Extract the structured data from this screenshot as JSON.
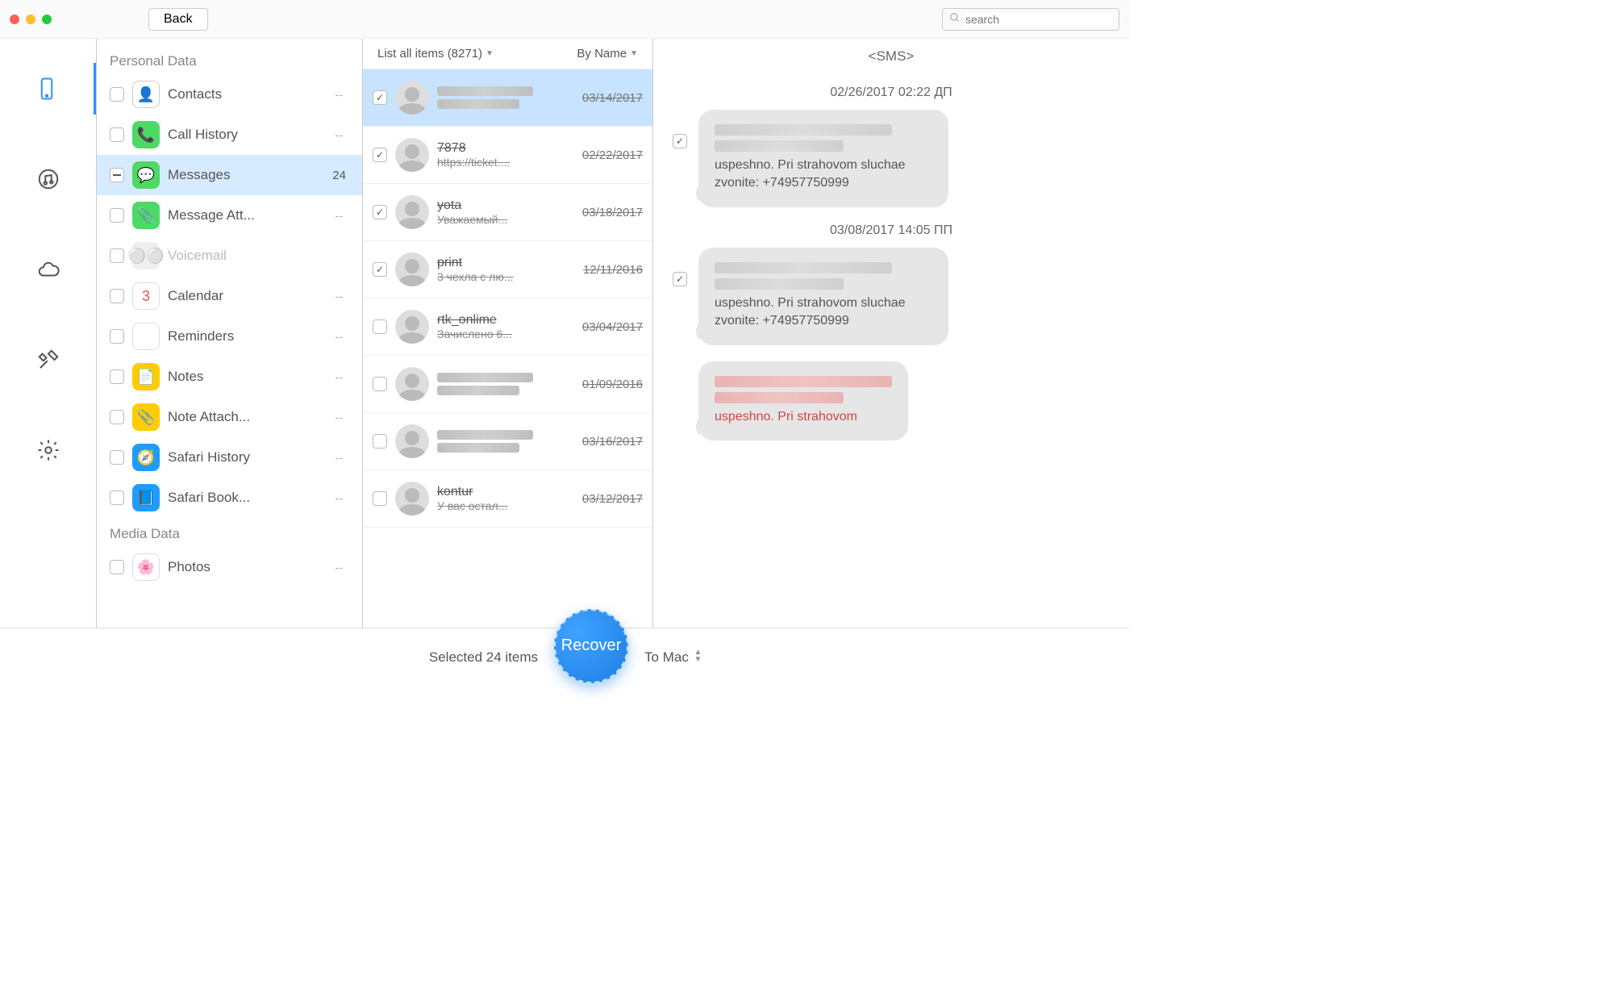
{
  "toolbar": {
    "back_label": "Back",
    "search_placeholder": "search"
  },
  "sidebar_icons": [
    {
      "name": "device",
      "active": true
    },
    {
      "name": "itunes",
      "active": false
    },
    {
      "name": "icloud",
      "active": false
    },
    {
      "name": "tools",
      "active": false
    },
    {
      "name": "settings",
      "active": false
    }
  ],
  "categories": {
    "groups": [
      {
        "title": "Personal Data",
        "items": [
          {
            "icon": "contacts",
            "label": "Contacts",
            "count": "--",
            "bg": "#fff",
            "border": "#ccc",
            "checked": false
          },
          {
            "icon": "call",
            "label": "Call History",
            "count": "--",
            "bg": "#4cd964",
            "checked": false
          },
          {
            "icon": "messages",
            "label": "Messages",
            "count": "24",
            "bg": "#4cd964",
            "checked": "minus",
            "selected": true
          },
          {
            "icon": "attach",
            "label": "Message Att...",
            "count": "--",
            "bg": "#4cd964",
            "checked": false
          },
          {
            "icon": "voicemail",
            "label": "Voicemail",
            "count": "",
            "bg": "#eee",
            "disabled": true,
            "checked": false
          },
          {
            "icon": "calendar",
            "label": "Calendar",
            "count": "--",
            "bg": "#fff",
            "border": "#ddd",
            "checked": false
          },
          {
            "icon": "reminders",
            "label": "Reminders",
            "count": "--",
            "bg": "#fff",
            "border": "#ddd",
            "checked": false
          },
          {
            "icon": "notes",
            "label": "Notes",
            "count": "--",
            "bg": "#ffcc00",
            "checked": false
          },
          {
            "icon": "noteatt",
            "label": "Note Attach...",
            "count": "--",
            "bg": "#ffcc00",
            "checked": false
          },
          {
            "icon": "safari",
            "label": "Safari History",
            "count": "--",
            "bg": "#1f9cff",
            "checked": false
          },
          {
            "icon": "safaribook",
            "label": "Safari Book...",
            "count": "--",
            "bg": "#1f9cff",
            "checked": false
          }
        ]
      },
      {
        "title": "Media Data",
        "items": [
          {
            "icon": "photos",
            "label": "Photos",
            "count": "--",
            "bg": "#fff",
            "border": "#ddd",
            "checked": false
          }
        ]
      }
    ]
  },
  "msg_header": {
    "filter": "List all items (8271)",
    "sort": "By Name"
  },
  "messages": [
    {
      "checked": true,
      "selected": true,
      "name": "",
      "sub": "",
      "date": "03/14/2017",
      "blurred": true
    },
    {
      "checked": true,
      "name": "7878",
      "sub": "https://ticket....",
      "date": "02/22/2017"
    },
    {
      "checked": true,
      "name": "yota",
      "sub": "Уважаемый...",
      "date": "03/18/2017"
    },
    {
      "checked": true,
      "name": "print",
      "sub": "3 чехла с лю...",
      "date": "12/11/2016"
    },
    {
      "checked": false,
      "name": "rtk_onlime",
      "sub": "Зачислено 6...",
      "date": "03/04/2017"
    },
    {
      "checked": false,
      "name": "",
      "sub": "",
      "date": "01/09/2016",
      "blurred": true
    },
    {
      "checked": false,
      "name": "",
      "sub": "",
      "date": "03/16/2017",
      "blurred": true
    },
    {
      "checked": false,
      "name": "kontur",
      "sub": "У вас остал...",
      "date": "03/12/2017"
    }
  ],
  "detail": {
    "title": "<SMS>",
    "thread": [
      {
        "type": "ts",
        "text": "02/26/2017 02:22 ДП"
      },
      {
        "type": "bubble",
        "checked": true,
        "readable": "uspeshno. Pri strahovom sluchae zvonite: +74957750999"
      },
      {
        "type": "ts",
        "text": "03/08/2017 14:05 ПП"
      },
      {
        "type": "bubble",
        "checked": true,
        "readable": "uspeshno. Pri strahovom sluchae zvonite: +74957750999"
      },
      {
        "type": "bubble",
        "checked": null,
        "red": true,
        "readable": "uspeshno. Pri strahovom"
      }
    ]
  },
  "footer": {
    "status": "Selected 24 items",
    "recover": "Recover",
    "target": "To Mac"
  }
}
